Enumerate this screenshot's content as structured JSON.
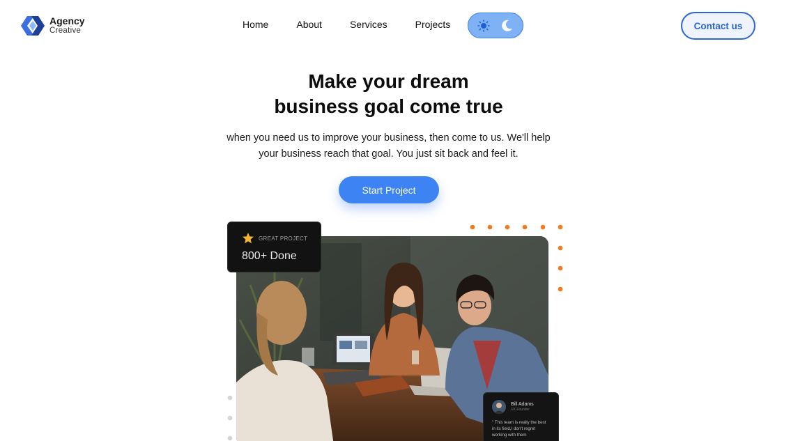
{
  "brand": {
    "title": "Agency",
    "subtitle": "Creative"
  },
  "nav": {
    "items": [
      "Home",
      "About",
      "Services",
      "Projects"
    ]
  },
  "theme_toggle": {
    "icons": [
      "sun-icon",
      "moon-icon"
    ],
    "accent": "#3c82f0"
  },
  "header": {
    "contact_label": "Contact us"
  },
  "hero": {
    "title_line1": "Make your dream",
    "title_line2": "business goal come true",
    "description": "when you need us to improve your business, then come to us. We'll help your business reach that goal. You just sit back and feel it.",
    "cta_label": "Start Project"
  },
  "badge": {
    "label": "GREAT PROJECT",
    "count": "800+ Done"
  },
  "testimonial": {
    "name": "Bill Adams",
    "role": "UX Founder",
    "quote": "\" This team is really the best in its field,I don't regret working with them"
  },
  "colors": {
    "primary": "#3d83f4",
    "contact_border": "#2c65d4",
    "dots": "#f47a20"
  }
}
